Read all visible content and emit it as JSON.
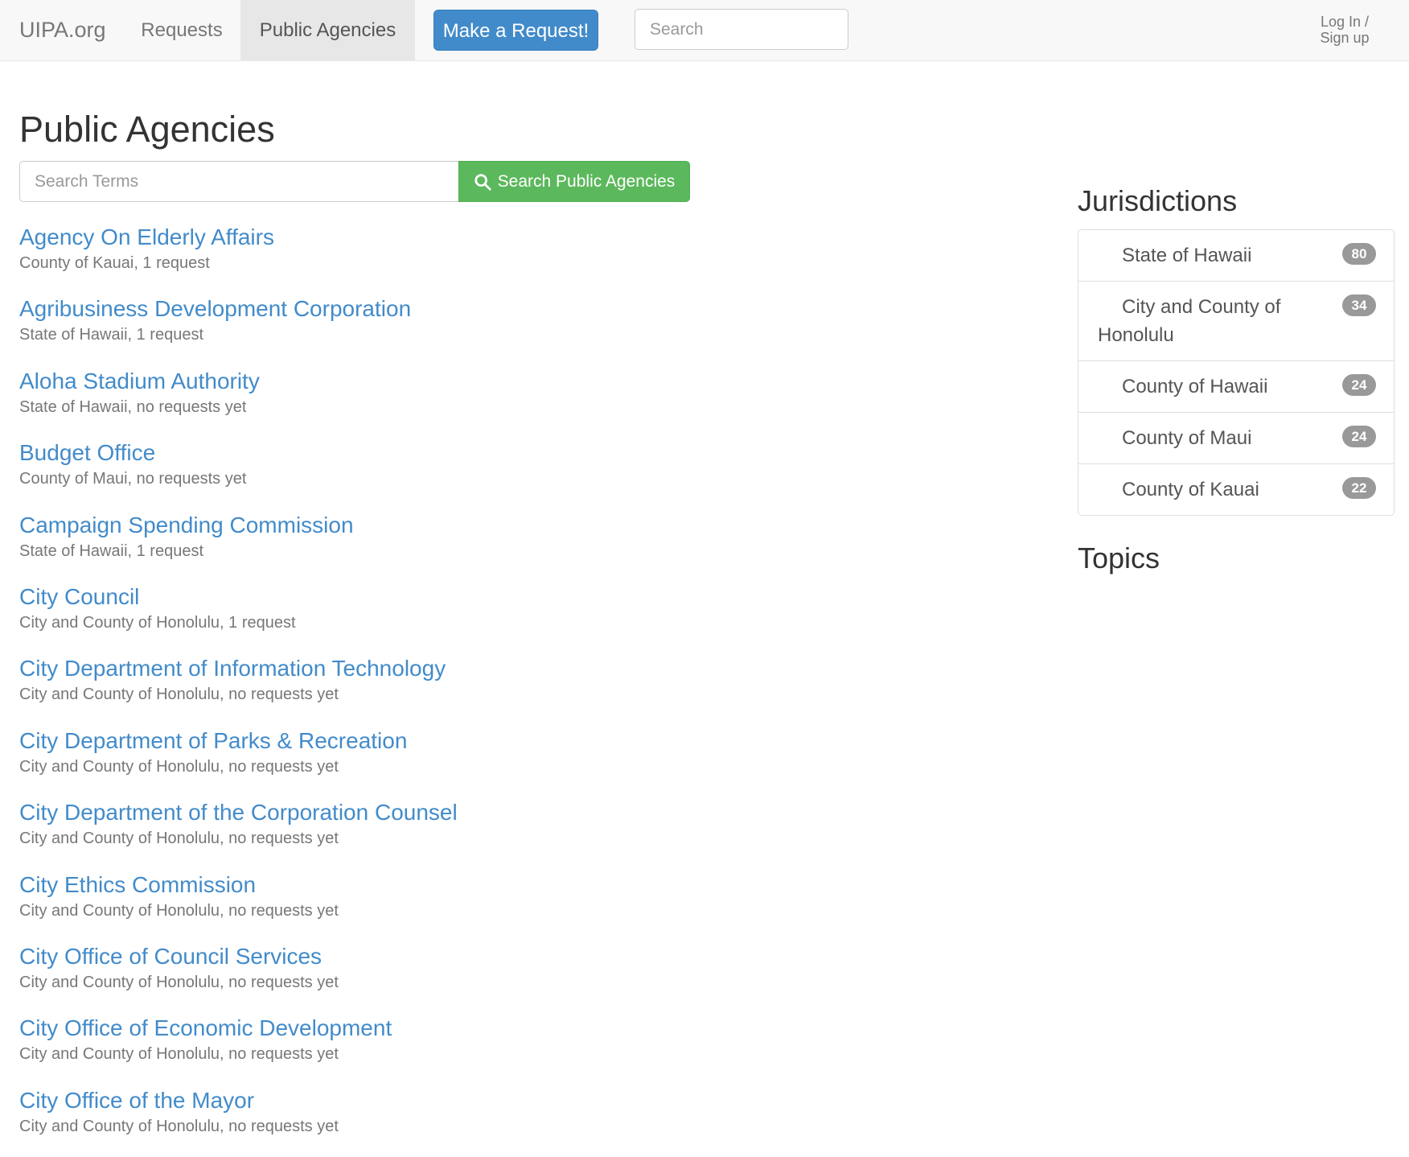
{
  "nav": {
    "brand": "UIPA.org",
    "requests": "Requests",
    "public_agencies": "Public Agencies",
    "make_request": "Make a Request!",
    "search_placeholder": "Search",
    "login_line1": "Log In /",
    "login_line2": "Sign up"
  },
  "main": {
    "title": "Public Agencies",
    "search_placeholder": "Search Terms",
    "search_button": "Search Public Agencies",
    "agencies": [
      {
        "name": "Agency On Elderly Affairs",
        "meta": "County of Kauai, 1 request"
      },
      {
        "name": "Agribusiness Development Corporation",
        "meta": "State of Hawaii, 1 request"
      },
      {
        "name": "Aloha Stadium Authority",
        "meta": "State of Hawaii, no requests yet"
      },
      {
        "name": "Budget Office",
        "meta": "County of Maui, no requests yet"
      },
      {
        "name": "Campaign Spending Commission",
        "meta": "State of Hawaii, 1 request"
      },
      {
        "name": "City Council",
        "meta": "City and County of Honolulu, 1 request"
      },
      {
        "name": "City Department of Information Technology",
        "meta": "City and County of Honolulu, no requests yet"
      },
      {
        "name": "City Department of Parks & Recreation",
        "meta": "City and County of Honolulu, no requests yet"
      },
      {
        "name": "City Department of the Corporation Counsel",
        "meta": "City and County of Honolulu, no requests yet"
      },
      {
        "name": "City Ethics Commission",
        "meta": "City and County of Honolulu, no requests yet"
      },
      {
        "name": "City Office of Council Services",
        "meta": "City and County of Honolulu, no requests yet"
      },
      {
        "name": "City Office of Economic Development",
        "meta": "City and County of Honolulu, no requests yet"
      },
      {
        "name": "City Office of the Mayor",
        "meta": "City and County of Honolulu, no requests yet"
      }
    ]
  },
  "sidebar": {
    "jurisdictions_heading": "Jurisdictions",
    "jurisdictions": [
      {
        "label": "State of Hawaii",
        "count": "80"
      },
      {
        "label": "City and County of Honolulu",
        "count": "34"
      },
      {
        "label": "County of Hawaii",
        "count": "24"
      },
      {
        "label": "County of Maui",
        "count": "24"
      },
      {
        "label": "County of Kauai",
        "count": "22"
      }
    ],
    "topics_heading": "Topics"
  },
  "colors": {
    "link": "#428bca",
    "primary_button": "#428bca",
    "success_button": "#5cb85c",
    "badge": "#999999",
    "navbar_bg": "#f8f8f8"
  },
  "icons": {
    "search_button_icon": "search-icon"
  }
}
